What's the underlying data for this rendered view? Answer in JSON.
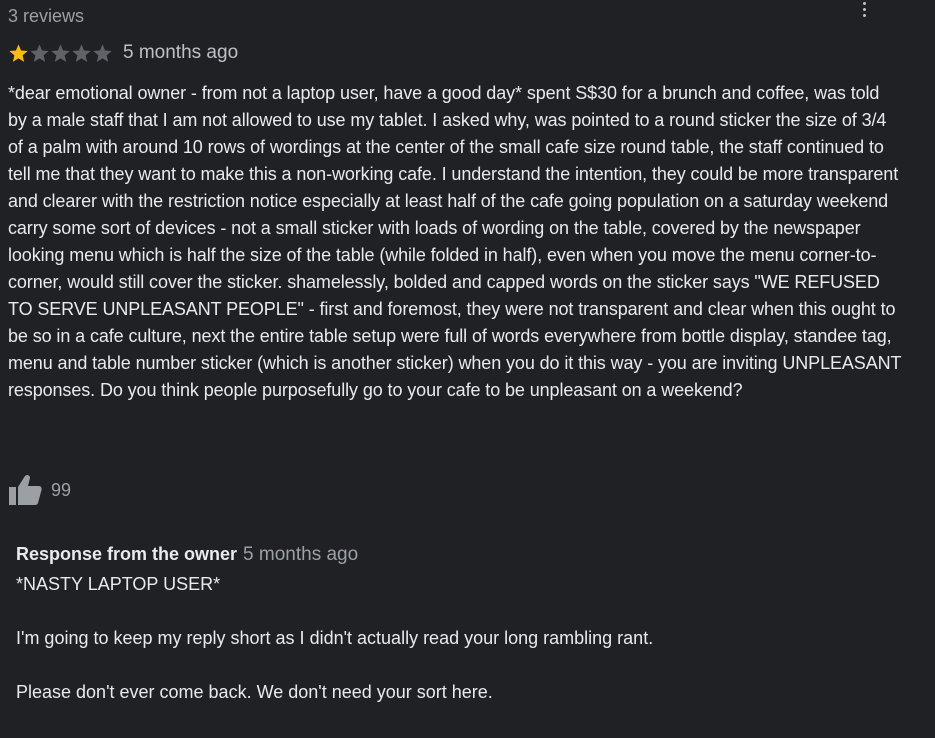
{
  "review": {
    "count_label": "3 reviews",
    "rating": 1,
    "max_rating": 5,
    "date": "5 months ago",
    "text": "*dear emotional owner - from not a laptop user, have a good day* spent S$30 for a brunch and coffee, was told by a male staff that I am not allowed to use my tablet. I asked why, was pointed to a round sticker the size of 3/4 of a palm with around 10 rows of wordings at the center of the small cafe size round table, the staff continued to tell me that they want to make this a non-working cafe. I understand the intention, they could be more transparent and clearer with the restriction notice especially at least half of the cafe going population on a saturday weekend carry some sort of devices - not a small sticker with loads of wording on the table, covered by the newspaper looking menu which is half the size of the table (while folded in half), even when you move the menu corner-to-corner, would still cover the sticker. shamelessly, bolded and capped words on the sticker says \"WE REFUSED TO SERVE UNPLEASANT PEOPLE\" - first and foremost, they were not transparent and clear when this ought to be so in a cafe culture, next the entire table setup were full of words everywhere from bottle display, standee tag, menu and table number sticker (which is another sticker) when you do it this way - you are inviting UNPLEASANT responses. Do you think people purposefully go to your cafe to be unpleasant on a weekend?",
    "likes": "99",
    "icons": {
      "menu": "more-vert-icon",
      "like": "thumbs-up-icon",
      "star": "star-icon"
    }
  },
  "owner_response": {
    "label": "Response from the owner",
    "date": "5 months ago",
    "paragraphs": [
      "*NASTY LAPTOP USER*",
      "I'm going to keep my reply short as I didn't actually read your long rambling rant.",
      "Please don't ever come back. We don't need your sort here."
    ]
  },
  "colors": {
    "background": "#202124",
    "text": "#e8eaed",
    "muted": "#9aa0a6",
    "star_filled": "#fbbc04",
    "star_empty": "#5f6368"
  }
}
